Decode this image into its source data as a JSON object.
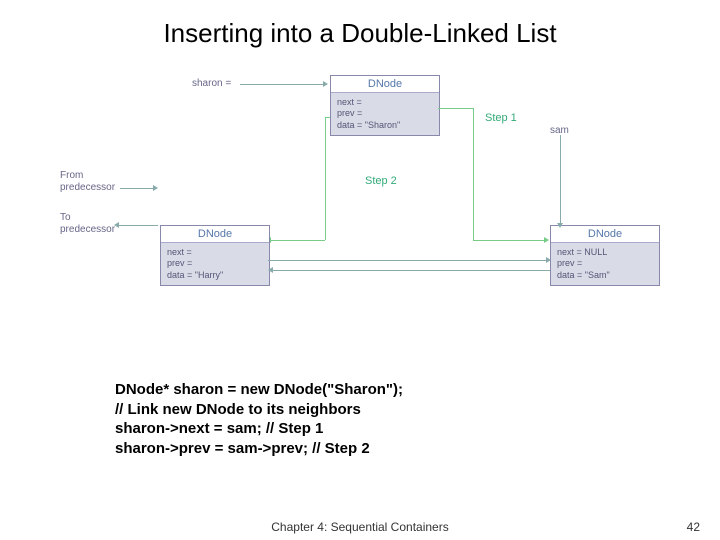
{
  "title": "Inserting into a Double-Linked List",
  "diagram": {
    "sharon_label": "sharon =",
    "sam_label": "sam",
    "from_pred": "From\npredecessor",
    "to_pred": "To\npredecessor",
    "step1": "Step 1",
    "step2": "Step 2",
    "sharon_node": {
      "head": "DNode",
      "body": "next =\nprev =\ndata = \"Sharon\""
    },
    "harry_node": {
      "head": "DNode",
      "body": "next =\nprev =\ndata = \"Harry\""
    },
    "sam_node": {
      "head": "DNode",
      "body": "next = NULL\nprev =\ndata = \"Sam\""
    }
  },
  "code": "DNode* sharon = new DNode(\"Sharon\");\n// Link new DNode to its neighbors\nsharon->next = sam; // Step 1\nsharon->prev = sam->prev; // Step 2",
  "footer": {
    "chapter": "Chapter 4: Sequential Containers",
    "page": "42"
  }
}
